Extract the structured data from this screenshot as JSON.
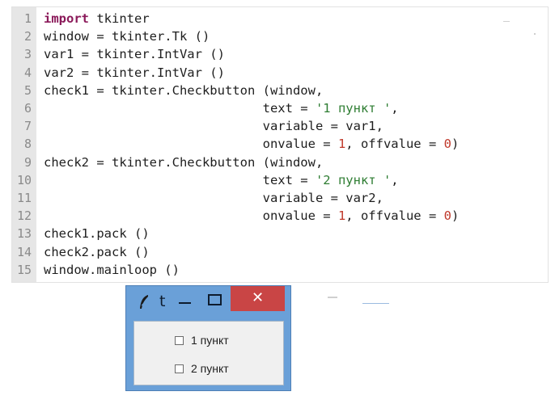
{
  "editor": {
    "lines": [
      {
        "n": "1",
        "tokens": [
          {
            "t": "import",
            "c": "kw"
          },
          {
            "t": " tkinter"
          }
        ]
      },
      {
        "n": "2",
        "tokens": [
          {
            "t": "window = tkinter.Tk ()"
          }
        ]
      },
      {
        "n": "3",
        "tokens": [
          {
            "t": "var1 = tkinter.IntVar ()"
          }
        ]
      },
      {
        "n": "4",
        "tokens": [
          {
            "t": "var2 = tkinter.IntVar ()"
          }
        ]
      },
      {
        "n": "5",
        "tokens": [
          {
            "t": "check1 = tkinter.Checkbutton (window,"
          }
        ]
      },
      {
        "n": "6",
        "tokens": [
          {
            "t": "                             text = "
          },
          {
            "t": "'1 пункт '",
            "c": "str"
          },
          {
            "t": ","
          }
        ]
      },
      {
        "n": "7",
        "tokens": [
          {
            "t": "                             variable = var1,"
          }
        ]
      },
      {
        "n": "8",
        "tokens": [
          {
            "t": "                             onvalue = "
          },
          {
            "t": "1",
            "c": "num"
          },
          {
            "t": ", offvalue = "
          },
          {
            "t": "0",
            "c": "num"
          },
          {
            "t": ")"
          }
        ]
      },
      {
        "n": "9",
        "tokens": [
          {
            "t": "check2 = tkinter.Checkbutton (window,"
          }
        ]
      },
      {
        "n": "10",
        "tokens": [
          {
            "t": "                             text = "
          },
          {
            "t": "'2 пункт '",
            "c": "str"
          },
          {
            "t": ","
          }
        ]
      },
      {
        "n": "11",
        "tokens": [
          {
            "t": "                             variable = var2,"
          }
        ]
      },
      {
        "n": "12",
        "tokens": [
          {
            "t": "                             onvalue = "
          },
          {
            "t": "1",
            "c": "num"
          },
          {
            "t": ", offvalue = "
          },
          {
            "t": "0",
            "c": "num"
          },
          {
            "t": ")"
          }
        ]
      },
      {
        "n": "13",
        "tokens": [
          {
            "t": "check1.pack ()"
          }
        ]
      },
      {
        "n": "14",
        "tokens": [
          {
            "t": "check2.pack ()"
          }
        ]
      },
      {
        "n": "15",
        "tokens": [
          {
            "t": "window.mainloop ()"
          }
        ]
      }
    ]
  },
  "tk_window": {
    "title": "t",
    "minimize_icon": "minimize-icon",
    "maximize_icon": "maximize-icon",
    "close_label": "✕",
    "app_icon": "feather-icon",
    "checkboxes": [
      {
        "label": "1 пункт",
        "checked": false
      },
      {
        "label": "2 пункт",
        "checked": false
      }
    ]
  },
  "colors": {
    "keyword": "#8b1a5a",
    "string": "#2e7d32",
    "number": "#c0392b",
    "titlebar": "#6aa0d8",
    "close_button": "#c94545"
  }
}
